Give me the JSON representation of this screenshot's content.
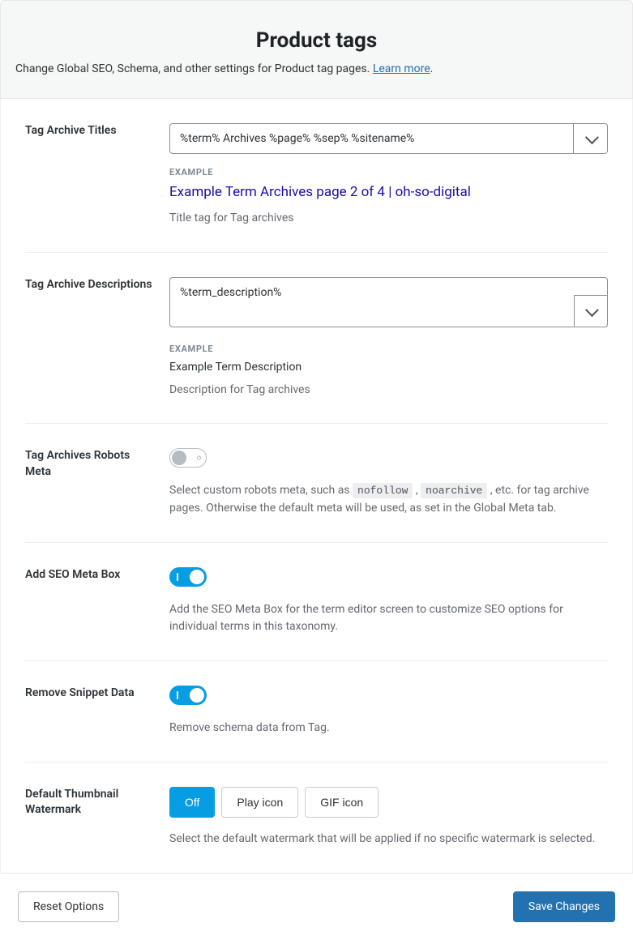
{
  "header": {
    "title": "Product tags",
    "subtitle_prefix": "Change Global SEO, Schema, and other settings for Product tag pages. ",
    "learn_more": "Learn more",
    "subtitle_suffix": "."
  },
  "fields": {
    "titles": {
      "label": "Tag Archive Titles",
      "value": "%term% Archives %page% %sep% %sitename%",
      "example_label": "EXAMPLE",
      "example_value": "Example Term Archives page 2 of 4 | oh-so-digital",
      "help": "Title tag for Tag archives"
    },
    "descriptions": {
      "label": "Tag Archive Descriptions",
      "value": "%term_description%",
      "example_label": "EXAMPLE",
      "example_value": "Example Term Description",
      "help": "Description for Tag archives"
    },
    "robots": {
      "label": "Tag Archives Robots Meta",
      "state": "off",
      "help_pre": "Select custom robots meta, such as ",
      "code1": "nofollow",
      "sep": " , ",
      "code2": "noarchive",
      "help_post": " , etc. for tag archive pages. Otherwise the default meta will be used, as set in the Global Meta tab."
    },
    "seo_box": {
      "label": "Add SEO Meta Box",
      "state": "on",
      "help": "Add the SEO Meta Box for the term editor screen to customize SEO options for individual terms in this taxonomy."
    },
    "snippet": {
      "label": "Remove Snippet Data",
      "state": "on",
      "help": "Remove schema data from Tag."
    },
    "watermark": {
      "label": "Default Thumbnail Watermark",
      "options": [
        "Off",
        "Play icon",
        "GIF icon"
      ],
      "selected": "Off",
      "help": "Select the default watermark that will be applied if no specific watermark is selected."
    }
  },
  "footer": {
    "reset": "Reset Options",
    "save": "Save Changes"
  }
}
